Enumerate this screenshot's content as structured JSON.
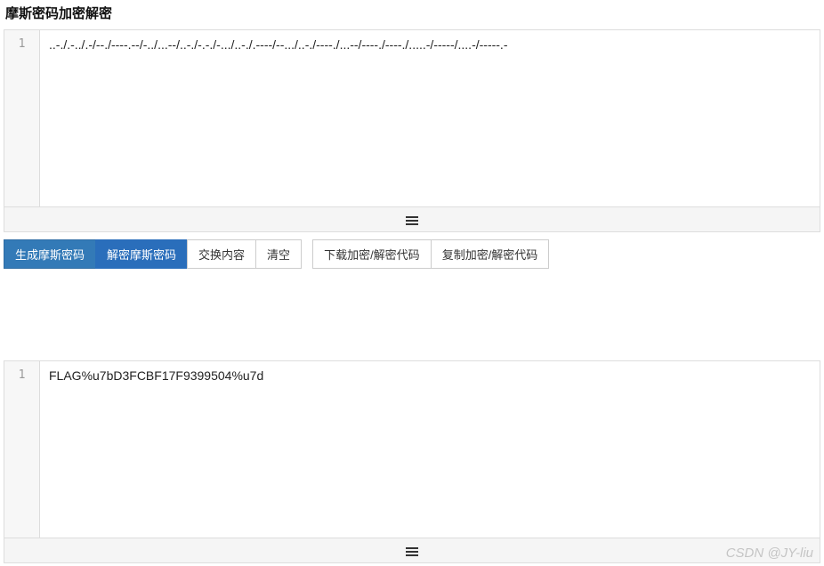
{
  "title": "摩斯密码加密解密",
  "editor1": {
    "line_number": "1",
    "content": "..-./.-../.-/--./----.--/-../...--/..-./-.-./-.../..-./.----/--.../..-./----./...--/----./----./.....-/-----/....-/-----.-"
  },
  "editor2": {
    "line_number": "1",
    "content": "FLAG%u7bD3FCBF17F9399504%u7d"
  },
  "toolbar": {
    "group1": {
      "generate": "生成摩斯密码",
      "decrypt": "解密摩斯密码",
      "swap": "交换内容",
      "clear": "清空"
    },
    "group2": {
      "download": "下载加密/解密代码",
      "copy": "复制加密/解密代码"
    }
  },
  "watermark": "CSDN @JY-liu"
}
